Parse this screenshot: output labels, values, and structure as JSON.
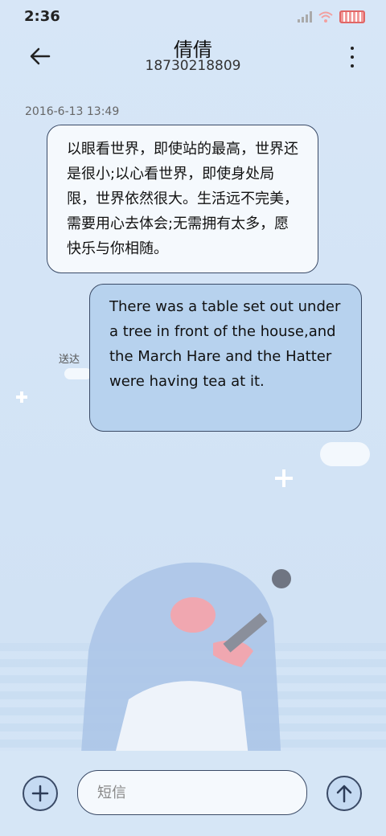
{
  "status_bar": {
    "time": "2:36",
    "icons": [
      "signal-icon",
      "wifi-icon",
      "battery-icon"
    ]
  },
  "header": {
    "contact_name": "倩倩",
    "phone_number": "18730218809"
  },
  "conversation": {
    "timestamp": "2016-6-13 13:49",
    "messages": [
      {
        "direction": "incoming",
        "text": "以眼看世界，即使站的最高，世界还是很小;以心看世界，即使身处局限，世界依然很大。生活远不完美，需要用心去体会;无需拥有太多，愿快乐与你相随。"
      },
      {
        "direction": "outgoing",
        "text": "There was a table set out under a tree in front of the house,and the March Hare and the Hatter were having tea at it.",
        "status": "送达"
      }
    ]
  },
  "composer": {
    "placeholder": "短信"
  },
  "colors": {
    "background": "#d7e6f7",
    "incoming_bubble": "#f5f9fd",
    "outgoing_bubble": "#b7d2ee",
    "outline": "#3a4a66"
  }
}
